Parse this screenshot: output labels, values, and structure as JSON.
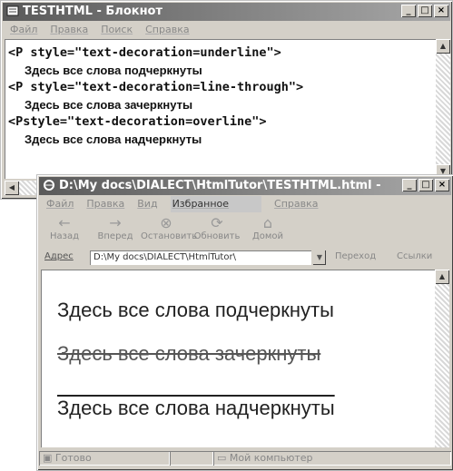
{
  "notepad": {
    "title": "TESTHTML - Блокнот",
    "menu": [
      "Файл",
      "Правка",
      "Поиск",
      "Справка"
    ],
    "code_lines": [
      "<P style=\"text-decoration=underline\">",
      "Здесь все слова подчеркнуты",
      "<P style=\"text-decoration=line-through\">",
      "Здесь все слова зачеркнуты",
      "<Pstyle=\"text-decoration=overline\">",
      "Здесь все слова надчеркнуты"
    ]
  },
  "browser": {
    "title": "D:\\My docs\\DIALECT\\HtmlTutor\\TESTHTML.html -",
    "menu": [
      "Файл",
      "Правка",
      "Вид",
      "Избранное",
      "Справка"
    ],
    "toolbar": [
      "Назад",
      "Вперед",
      "Остановить",
      "Обновить",
      "Домой"
    ],
    "address_label": "Адрес",
    "address_value": "D:\\My docs\\DIALECT\\HtmlTutor\\",
    "go_label": "Переход",
    "links_label": "Ссылки",
    "content": [
      "Здесь все слова подчеркнуты",
      "Здесь все слова зачеркнуты",
      "Здесь все слова надчеркнуты"
    ],
    "status_ready": "Готово",
    "status_zone": "Мой компьютер"
  },
  "colors": {
    "titlebar_start": "#5a5a5a",
    "titlebar_end": "#a8a8a8",
    "chrome": "#d4d0c8"
  }
}
